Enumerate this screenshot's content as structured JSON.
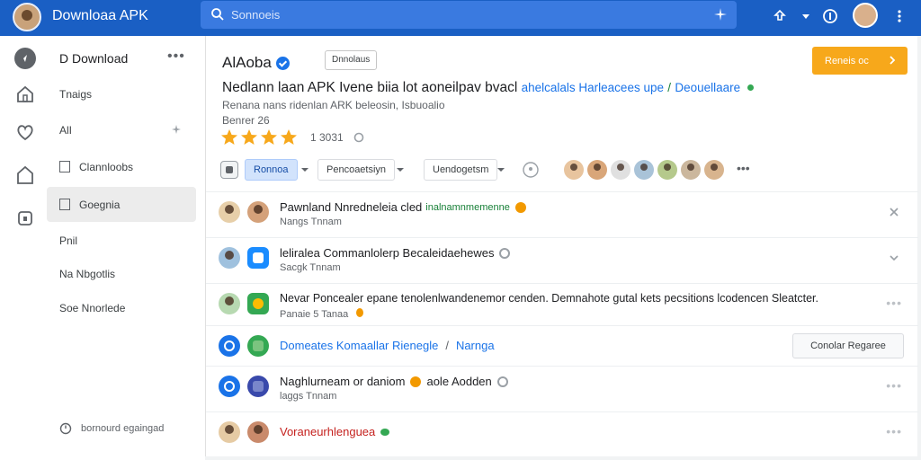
{
  "topbar": {
    "app_title": "Downloaa APK",
    "search_placeholder": "Sonnoeis",
    "colors": {
      "bar": "#1a5fc4",
      "search": "#3a7ae0"
    }
  },
  "sidebar": {
    "header": "D Download",
    "more": "•••",
    "items": [
      {
        "label": "Tnaigs"
      },
      {
        "label": "AlI"
      },
      {
        "label": "Clannloobs"
      },
      {
        "label": "Goegnia"
      },
      {
        "label": "Pnil"
      },
      {
        "label": "Na Nbgotlis"
      },
      {
        "label": "Soe Nnorlede"
      }
    ],
    "footer": "bornourd egaingad"
  },
  "app": {
    "name": "AlAoba",
    "chip": "Dnnolaus",
    "primary_button": "Reneis oc",
    "headline": "Nedlann laan APK Ivene biia lot aoneilpav bvacl",
    "headline_link": "ahelcalals Harleacees upe",
    "headline_sep": "/",
    "headline_link2": "Deouellaare",
    "subline": "Renana nans ridenlan ARK beleosin, Isbuoalio",
    "subline2": "Benrer 26",
    "rating_value": "1 3031",
    "star_count": 4,
    "accent": "#f7a81b"
  },
  "toolbar": {
    "filter_active": "Ronnoa",
    "filter_2": "Pencoaetsiyn",
    "filter_3": "Uendogetsm",
    "more": "•••"
  },
  "rows": [
    {
      "title": "Pawnland Nnredneleia cled",
      "tag": "inalnamnmemenne",
      "meta": "Nangs Tnnam",
      "action": "close"
    },
    {
      "title": "leliralea Commanlolerp Becaleidaehewes",
      "meta": "Sacgk Tnnam",
      "action": "chevron"
    },
    {
      "title": "Nevar Poncealer epane tenolenlwandenemor cenden. Demnahote gutal kets pecsitions lcodencen Sleatcter.",
      "meta": "Panaie 5 Tanaa",
      "action": "dots"
    },
    {
      "title": "Domeates Komaallar Rienegle",
      "title_link": "Narnga",
      "sep": "/",
      "button": "Conolar Regaree"
    },
    {
      "title": "Naghlurneam or daniom",
      "tag_link": "aole Aodden",
      "meta": "laggs Tnnam",
      "action": "dots"
    },
    {
      "title": "Voraneurhlenguea",
      "action": "dots"
    }
  ]
}
